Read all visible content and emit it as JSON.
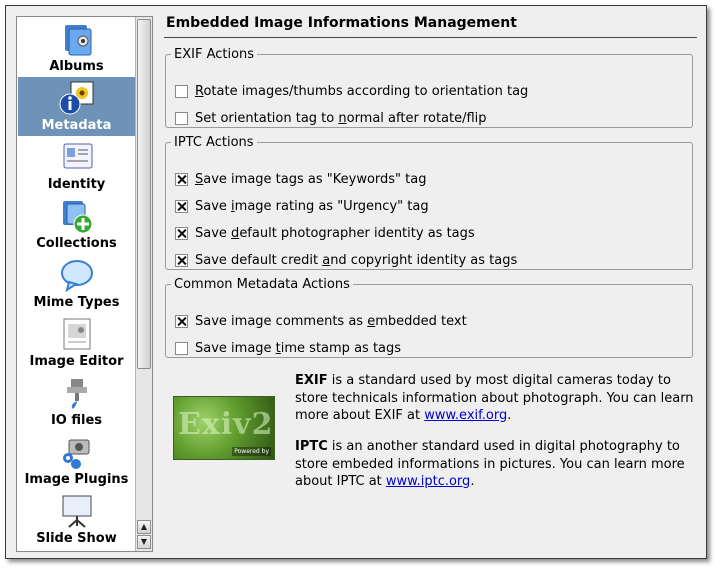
{
  "sidebar": {
    "items": [
      {
        "label": "Albums",
        "icon": "albums-icon"
      },
      {
        "label": "Metadata",
        "icon": "metadata-icon",
        "selected": true
      },
      {
        "label": "Identity",
        "icon": "identity-icon"
      },
      {
        "label": "Collections",
        "icon": "collections-icon"
      },
      {
        "label": "Mime Types",
        "icon": "mime-types-icon"
      },
      {
        "label": "Image Editor",
        "icon": "image-editor-icon"
      },
      {
        "label": "IO files",
        "icon": "io-files-icon"
      },
      {
        "label": "Image Plugins",
        "icon": "image-plugins-icon"
      },
      {
        "label": "Slide Show",
        "icon": "slide-show-icon"
      }
    ]
  },
  "main": {
    "title": "Embedded Image Informations Management",
    "exif": {
      "legend": "EXIF Actions",
      "options": [
        {
          "pre": "",
          "u": "R",
          "post": "otate images/thumbs according to orientation tag",
          "checked": false
        },
        {
          "pre": "Set orientation tag to ",
          "u": "n",
          "post": "ormal after rotate/flip",
          "checked": false
        }
      ]
    },
    "iptc": {
      "legend": "IPTC Actions",
      "options": [
        {
          "pre": "",
          "u": "S",
          "post": "ave image tags as \"Keywords\" tag",
          "checked": true
        },
        {
          "pre": "Save ",
          "u": "i",
          "post": "mage rating as \"Urgency\" tag",
          "checked": true
        },
        {
          "pre": "Save ",
          "u": "d",
          "post": "efault photographer identity as tags",
          "checked": true
        },
        {
          "pre": "Save default credit ",
          "u": "a",
          "post": "nd copyright identity as tags",
          "checked": true
        }
      ]
    },
    "common": {
      "legend": "Common Metadata Actions",
      "options": [
        {
          "pre": "Save image comments as ",
          "u": "e",
          "post": "mbedded text",
          "checked": true
        },
        {
          "pre": "Save image ",
          "u": "t",
          "post": "ime stamp as tags",
          "checked": false
        }
      ]
    },
    "logo": {
      "text": "Exiv2",
      "badge": "Powered by"
    },
    "exif_info": {
      "term": "EXIF",
      "text": " is a standard used by most digital cameras today to store technicals information about photograph. You can learn more about EXIF at ",
      "link": "www.exif.org",
      "tail": "."
    },
    "iptc_info": {
      "term": "IPTC",
      "text": " is an another standard used in digital photography to store embeded informations in pictures. You can learn more about IPTC at ",
      "link": "www.iptc.org",
      "tail": "."
    }
  },
  "colors": {
    "selection": "#6f93b8",
    "link": "#0000cc",
    "window_bg": "#efefef"
  }
}
